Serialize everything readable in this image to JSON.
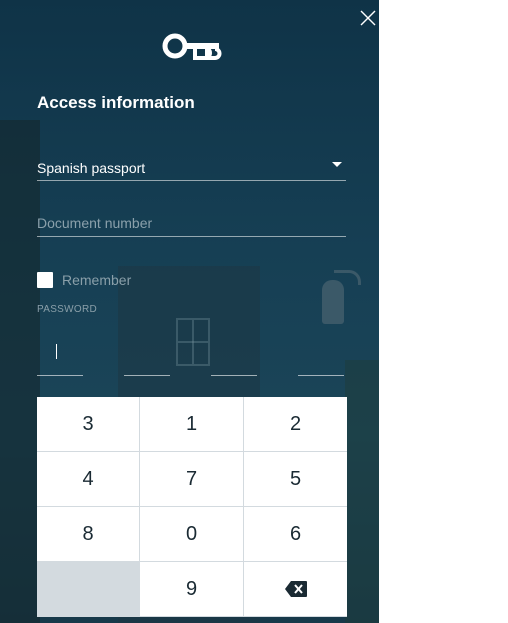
{
  "form": {
    "title": "Access information",
    "document_type": {
      "selected": "Spanish passport"
    },
    "document_number": {
      "value": "",
      "placeholder": "Document number"
    },
    "remember_label": "Remember",
    "password_label": "PASSWORD",
    "pin_slots": 4
  },
  "keypad": {
    "rows": [
      [
        "3",
        "1",
        "2"
      ],
      [
        "4",
        "7",
        "5"
      ],
      [
        "8",
        "0",
        "6"
      ],
      [
        "",
        "9",
        "backspace"
      ]
    ]
  },
  "icons": {
    "close": "close-icon",
    "logo": "key-logo-icon",
    "backspace": "backspace-icon",
    "dropdown": "chevron-down-icon"
  },
  "colors": {
    "panel_bg": "#163f54",
    "text_primary": "#ffffff",
    "text_muted": "#8a9fa9",
    "keypad_bg": "#ffffff",
    "keypad_gap": "#d3dadf"
  }
}
